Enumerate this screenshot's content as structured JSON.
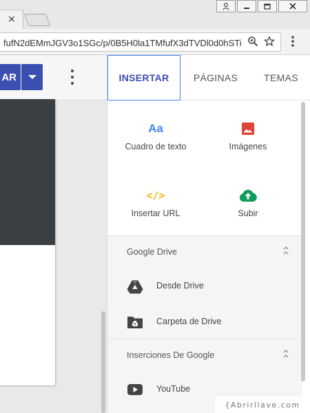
{
  "browser": {
    "tab_close_glyph": "×",
    "url": "fufN2dEMmJGV3o1SGc/p/0B5H0la1TMfufX3dTVDl0d0hSTi",
    "zoom_icon": "zoom-icon",
    "star_icon": "star-icon",
    "menu_icon": "more-vert-icon"
  },
  "editor": {
    "main_button_label": "AR",
    "accent_color": "#3b4fb0"
  },
  "panel": {
    "tabs": [
      {
        "label": "INSERTAR",
        "active": true
      },
      {
        "label": "PÁGINAS",
        "active": false
      },
      {
        "label": "TEMAS",
        "active": false
      }
    ],
    "grid": [
      {
        "label": "Cuadro de texto",
        "icon": "text-box-icon",
        "glyph": "Aa"
      },
      {
        "label": "Imágenes",
        "icon": "image-icon"
      },
      {
        "label": "Insertar URL",
        "icon": "code-icon",
        "glyph": "</>"
      },
      {
        "label": "Subir",
        "icon": "upload-icon"
      }
    ],
    "sections": [
      {
        "title": "Google Drive",
        "items": [
          {
            "label": "Desde Drive",
            "icon": "drive-icon"
          },
          {
            "label": "Carpeta de Drive",
            "icon": "drive-folder-icon"
          }
        ]
      },
      {
        "title": "Inserciones De Google",
        "items": [
          {
            "label": "YouTube",
            "icon": "youtube-icon"
          }
        ]
      }
    ]
  },
  "watermark": "{Abrirllave.com"
}
